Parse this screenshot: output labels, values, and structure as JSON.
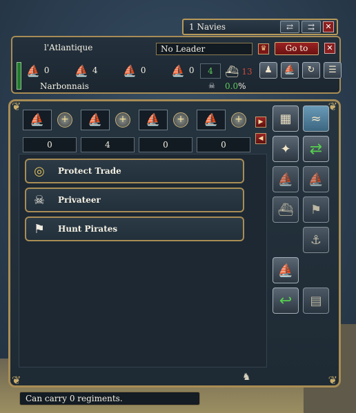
{
  "navies": {
    "label": "1 Navies",
    "swap_icon": "swap-arrows-icon",
    "merge_icon": "merge-arrows-icon",
    "close_label": "✕"
  },
  "fleet": {
    "name": "l'Atlantique",
    "leader": "No Leader",
    "goto_label": "Go to",
    "close_label": "✕",
    "ships": [
      {
        "icon": "⛵",
        "name": "heavy-ship",
        "count": "0"
      },
      {
        "icon": "⛵",
        "name": "light-ship",
        "count": "4"
      },
      {
        "icon": "⛵",
        "name": "galley",
        "count": "0"
      },
      {
        "icon": "⛵",
        "name": "transport",
        "count": "0"
      }
    ],
    "green_value": "4",
    "red_value": "13",
    "location": "Narbonnais",
    "percent_value": "0.0",
    "percent_sign": "%"
  },
  "ship_types": [
    {
      "value": "0"
    },
    {
      "value": "4"
    },
    {
      "value": "0"
    },
    {
      "value": "0"
    }
  ],
  "missions": [
    {
      "label": "Protect Trade",
      "icon": "coins-trade-icon",
      "glyph": "◎"
    },
    {
      "label": "Privateer",
      "icon": "skull-crossbones-icon",
      "glyph": "☠"
    },
    {
      "label": "Hunt Pirates",
      "icon": "pirate-flag-icon",
      "glyph": "⚑"
    }
  ],
  "status": {
    "text": "Can carry 0 regiments."
  },
  "colors": {
    "gold_border": "#a98d55",
    "panel": "#24313d",
    "green_text": "#5fcc5a",
    "red_text": "#d24a3a",
    "goto_red": "#9b2121"
  }
}
